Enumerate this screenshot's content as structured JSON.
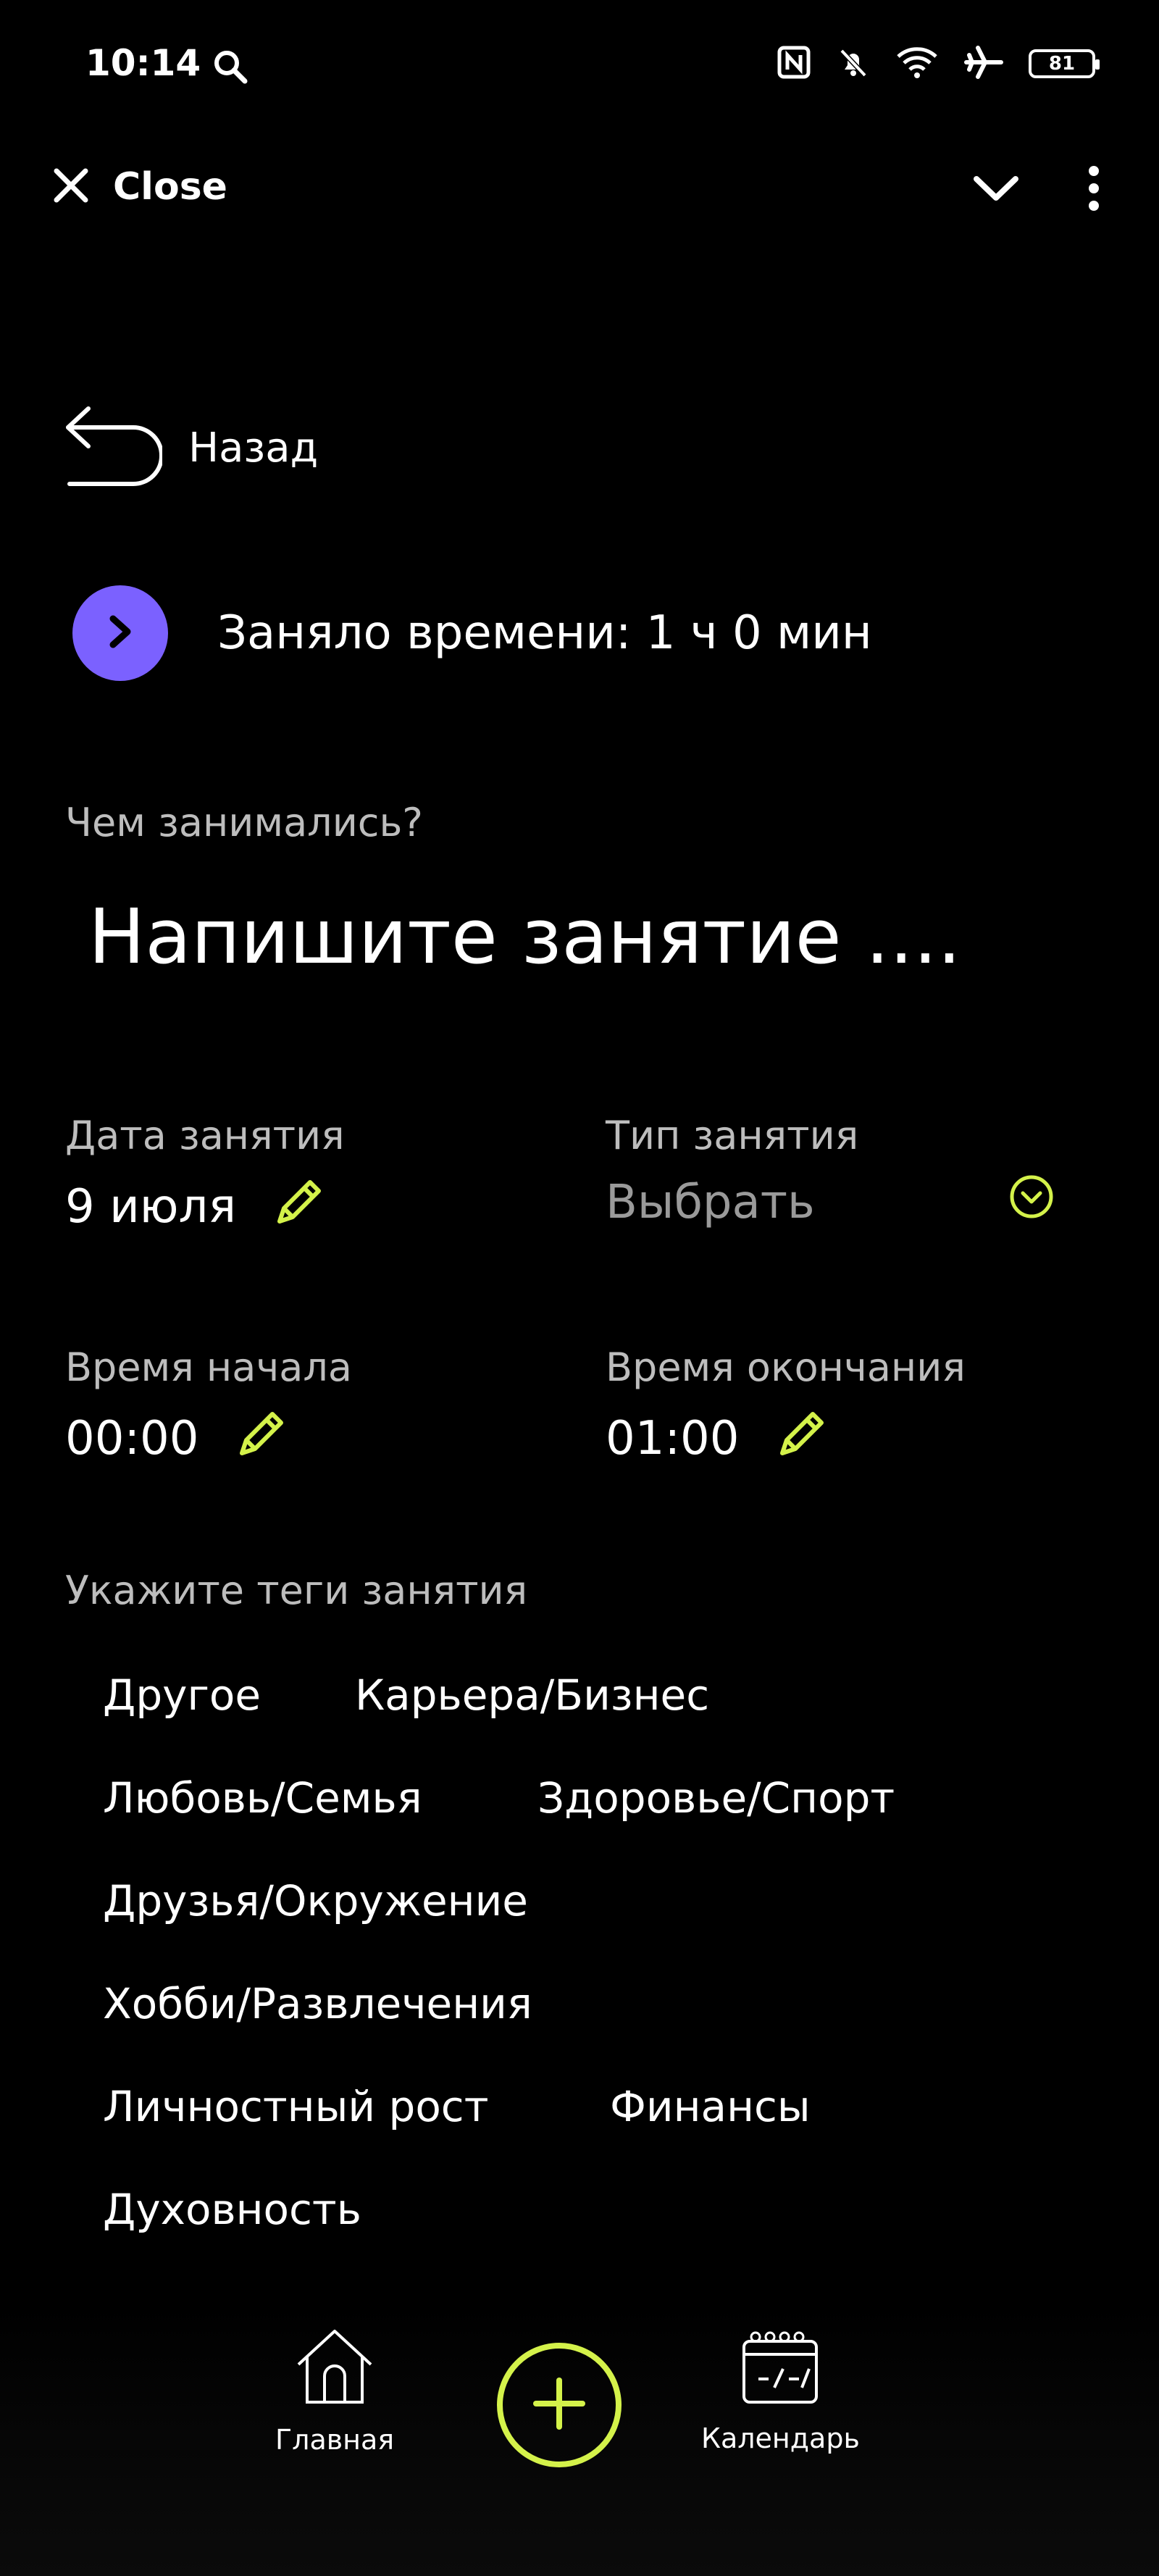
{
  "status_bar": {
    "time": "10:14",
    "battery": "81"
  },
  "top_bar": {
    "close_label": "Close"
  },
  "back": {
    "label": "Назад"
  },
  "time_taken": {
    "text": "Заняло времени: 1 ч 0 мин"
  },
  "activity": {
    "question": "Чем занимались?",
    "placeholder": "Напишите занятие ...."
  },
  "fields": {
    "date_label": "Дата занятия",
    "date_value": "9 июля",
    "type_label": "Тип занятия",
    "type_value": "Выбрать",
    "start_label": "Время начала",
    "start_value": "00:00",
    "end_label": "Время окончания",
    "end_value": "01:00"
  },
  "tags": {
    "title": "Укажите теги занятия",
    "items": [
      "Другое",
      "Карьера/Бизнес",
      "Любовь/Семья",
      "Здоровье/Спорт",
      "Друзья/Окружение",
      "Хобби/Развлечения",
      "Личностный рост",
      "Финансы",
      "Духовность"
    ]
  },
  "bottom_nav": {
    "home_label": "Главная",
    "calendar_label": "Календарь"
  },
  "colors": {
    "accent": "#d4f24a",
    "primary_button": "#7b61ff",
    "background": "#000000"
  }
}
